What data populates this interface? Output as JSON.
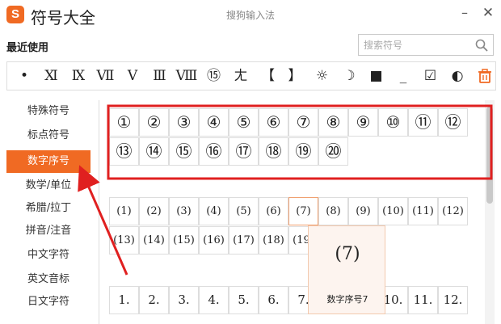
{
  "window": {
    "app_title": "符号大全",
    "center_title": "搜狗输入法",
    "logo_letter": "S",
    "minimize_label": "–",
    "close_label": "✕"
  },
  "recent": {
    "label": "最近使用",
    "symbols": [
      "•",
      "Ⅺ",
      "Ⅸ",
      "Ⅶ",
      "Ⅴ",
      "Ⅲ",
      "Ⅷ",
      "⑮",
      "ㄤ",
      "【",
      "】",
      "☼",
      "☽",
      "■",
      "_",
      "☑",
      "◐"
    ]
  },
  "search": {
    "placeholder": "搜索符号"
  },
  "sidebar": {
    "items": [
      {
        "label": "特殊符号"
      },
      {
        "label": "标点符号"
      },
      {
        "label": "数字序号",
        "active": true
      },
      {
        "label": "数学/单位"
      },
      {
        "label": "希腊/拉丁"
      },
      {
        "label": "拼音/注音"
      },
      {
        "label": "中文字符"
      },
      {
        "label": "英文音标"
      },
      {
        "label": "日文字符"
      }
    ]
  },
  "grid": {
    "circled_row1": [
      "①",
      "②",
      "③",
      "④",
      "⑤",
      "⑥",
      "⑦",
      "⑧",
      "⑨",
      "⑩",
      "⑪",
      "⑫"
    ],
    "circled_row2": [
      "⑬",
      "⑭",
      "⑮",
      "⑯",
      "⑰",
      "⑱",
      "⑲",
      "⑳"
    ],
    "paren_row1": [
      "(1)",
      "(2)",
      "(3)",
      "(4)",
      "(5)",
      "(6)",
      "(7)",
      "(8)",
      "(9)",
      "(10)",
      "(11)",
      "(12)"
    ],
    "paren_row2": [
      "(13)",
      "(14)",
      "(15)",
      "(16)",
      "(17)",
      "(18)",
      "(19)"
    ],
    "dot_row": [
      "1.",
      "2.",
      "3.",
      "4.",
      "5.",
      "6.",
      "7.",
      "",
      "",
      "10.",
      "11.",
      "12."
    ]
  },
  "tooltip": {
    "symbol": "(7)",
    "name": "数字序号7"
  },
  "colors": {
    "accent": "#f06a23",
    "highlight_box": "#e02020"
  }
}
